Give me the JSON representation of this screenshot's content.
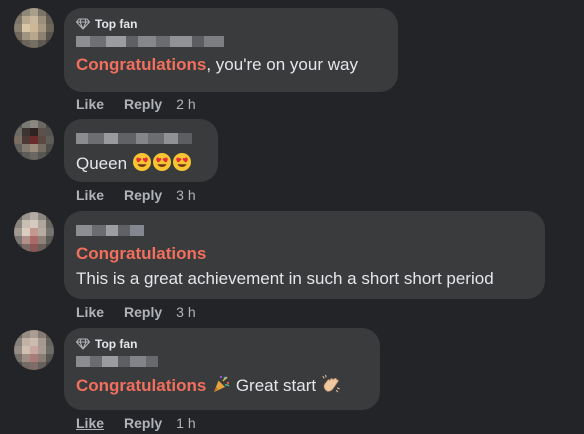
{
  "comments": [
    {
      "badge": "Top fan",
      "highlight": "Congratulations",
      "text": ", you're on your way",
      "like": "Like",
      "reply": "Reply",
      "time": "2 h"
    },
    {
      "text": "Queen",
      "emojis": [
        "heart-eyes-emoji",
        "heart-eyes-emoji",
        "heart-eyes-emoji"
      ],
      "like": "Like",
      "reply": "Reply",
      "time": "3 h"
    },
    {
      "highlight": "Congratulations",
      "text": "This is a great achievement in such a short short period",
      "like": "Like",
      "reply": "Reply",
      "time": "3 h"
    },
    {
      "badge": "Top fan",
      "highlight": "Congratulations",
      "text": "Great start",
      "emojis": [
        "party-popper-emoji",
        "clapping-hands-emoji"
      ],
      "like": "Like",
      "reply": "Reply",
      "time": "1 h"
    }
  ],
  "colors": {
    "background": "#232427",
    "bubble": "#3a3b3c",
    "highlight": "#f26f5e",
    "text": "#e4e6eb",
    "muted": "#b0b3b8"
  }
}
